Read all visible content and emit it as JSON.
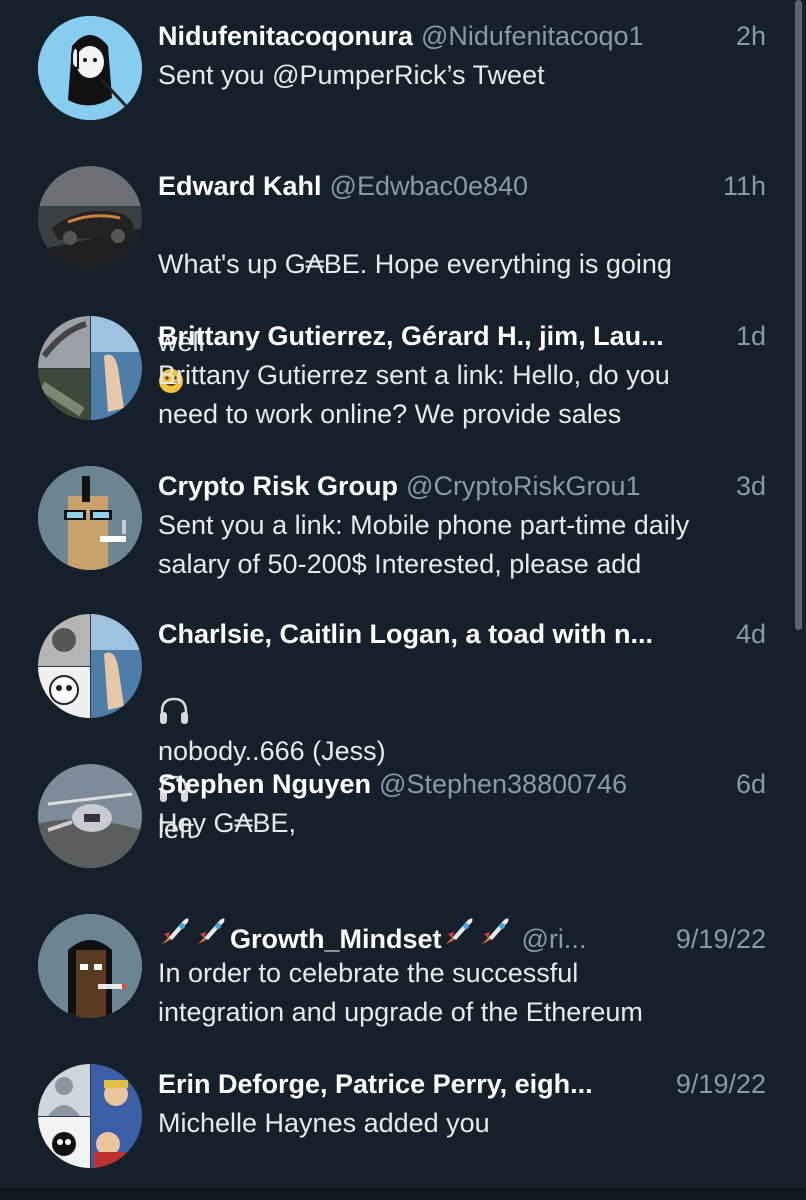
{
  "conversations": [
    {
      "name": "Nidufenitacoqonura",
      "handle": "@Nidufenitacoqo1",
      "time": "2h",
      "preview": "Sent you @PumperRick’s Tweet"
    },
    {
      "name": "Edward Kahl",
      "handle": "@Edwbac0e840",
      "time": "11h",
      "preview_line1": "What's up G₳BE. Hope everything is going",
      "preview_line2": "well"
    },
    {
      "name": "Brittany Gutierrez, Gérard H., jim, Lau...",
      "handle": "",
      "time": "1d",
      "preview": "Brittany Gutierrez sent a link: Hello, do you\nneed to work online? We provide sales"
    },
    {
      "name": "Crypto Risk Group",
      "handle": "@CryptoRiskGrou1",
      "time": "3d",
      "preview": "Sent you a link: Mobile phone part-time daily\nsalary of 50-200$ Interested, please add"
    },
    {
      "name": "Charlsie, Caitlin Logan, a toad with n...",
      "handle": "",
      "time": "4d",
      "preview_mid": "nobody..666 (Jess)",
      "preview_end": "left"
    },
    {
      "name": "Stephen Nguyen",
      "handle": "@Stephen38800746",
      "time": "6d",
      "preview": "Hey G₳BE,"
    },
    {
      "name": "Growth_Mindset",
      "handle": "@ri...",
      "time": "9/19/22",
      "preview": "In order to celebrate the successful\nintegration and upgrade of the Ethereum"
    },
    {
      "name": "Erin Deforge, Patrice Perry, eigh...",
      "handle": "",
      "time": "9/19/22",
      "preview": "Michelle Haynes added you"
    }
  ],
  "icons": {
    "emoji_grin": "grinning-face-emoji",
    "headphones": "headphones-emoji",
    "rocket": "rocket-emoji"
  },
  "colors": {
    "background": "#15202b",
    "secondary_text": "#8b98a5",
    "primary_text": "#ffffff"
  }
}
